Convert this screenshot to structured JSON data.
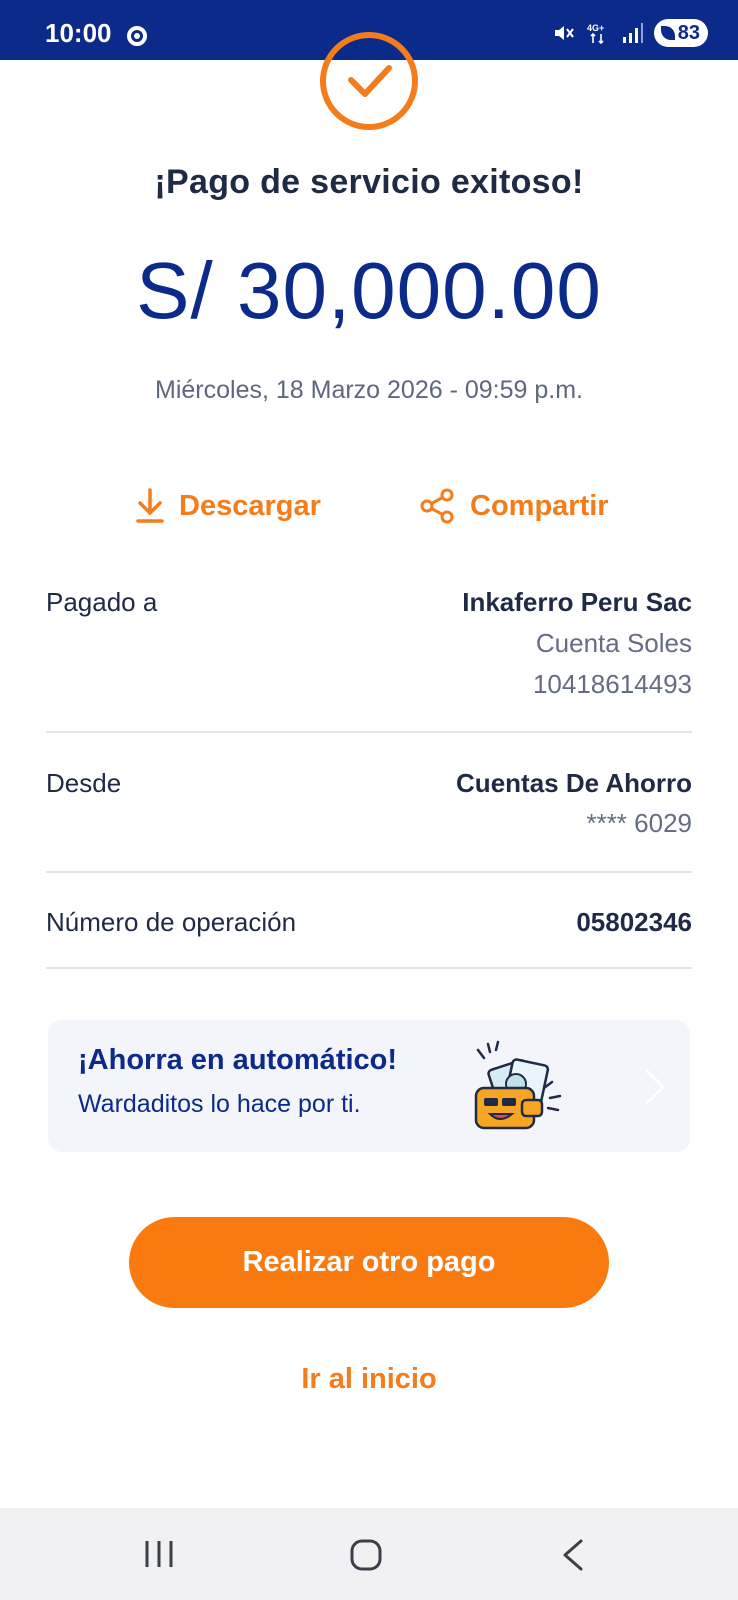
{
  "status_bar": {
    "time": "10:00",
    "battery": "83",
    "network": "4G+",
    "icons": [
      "chrome-icon",
      "mute-icon",
      "network-4g-icon",
      "signal-icon",
      "battery-icon"
    ]
  },
  "receipt": {
    "title": "¡Pago de servicio exitoso!",
    "amount": "S/ 30,000.00",
    "datetime": "Miércoles, 18 Marzo 2026 - 09:59 p.m."
  },
  "actions": {
    "download_label": "Descargar",
    "share_label": "Compartir"
  },
  "details": {
    "paid_to": {
      "label": "Pagado a",
      "name": "Inkaferro Peru Sac",
      "account_type": "Cuenta Soles",
      "account_number": "10418614493"
    },
    "from": {
      "label": "Desde",
      "account_name": "Cuentas De Ahorro",
      "account_masked": "**** 6029"
    },
    "operation": {
      "label": "Número de operación",
      "number": "05802346"
    }
  },
  "promo": {
    "title": "¡Ahorra en automático!",
    "subtitle": "Wardaditos lo hace por ti."
  },
  "buttons": {
    "primary": "Realizar otro pago",
    "secondary": "Ir al inicio"
  },
  "colors": {
    "brand_blue": "#0b2a8a",
    "accent_orange": "#f97b10",
    "text_dark": "#1f2a44",
    "text_muted": "#646d84"
  }
}
